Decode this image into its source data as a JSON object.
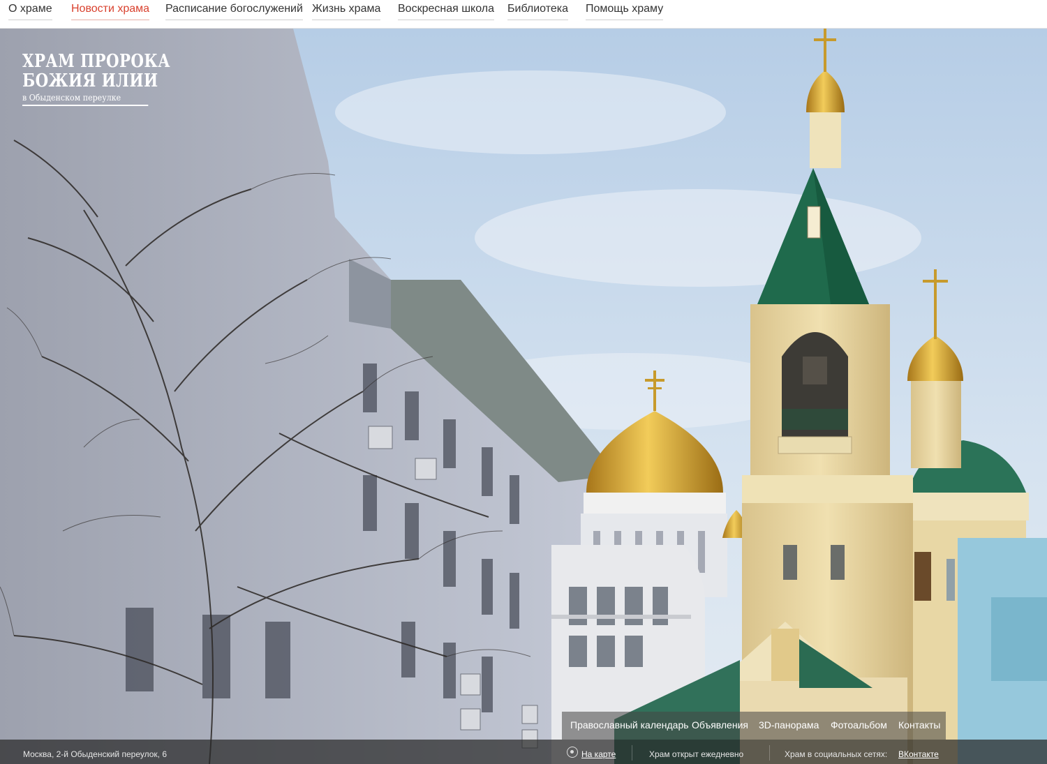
{
  "nav": {
    "items": [
      {
        "label": "О храме",
        "active": false
      },
      {
        "label": "Новости храма",
        "active": true
      },
      {
        "label": "Расписание богослужений",
        "active": false
      },
      {
        "label": "Жизнь храма",
        "active": false
      },
      {
        "label": "Воскресная школа",
        "active": false
      },
      {
        "label": "Библиотека",
        "active": false
      },
      {
        "label": "Помощь храму",
        "active": false
      }
    ]
  },
  "logo": {
    "line1": "Храм Пророка",
    "line2": "Божия Илии",
    "line3": "в Обыденском переулке"
  },
  "submenu": {
    "items": [
      {
        "label": "Православный календарь"
      },
      {
        "label": "Объявления"
      },
      {
        "label": "3D-панорама"
      },
      {
        "label": "Фотоальбом"
      },
      {
        "label": "Контакты"
      }
    ]
  },
  "footer": {
    "address": "Москва, 2-й Обыденский переулок, 6",
    "map_link": "На карте",
    "open_text": "Храм открыт ежедневно",
    "social_prefix": "Храм в социальных сетях:",
    "social_link": "ВКонтакте"
  },
  "colors": {
    "accent": "#d9412e",
    "sky": "#c9dcee",
    "dome_gold": "#d4a52a",
    "roof_green": "#1f6a4c",
    "bell_tower": "#ecd9a4"
  }
}
